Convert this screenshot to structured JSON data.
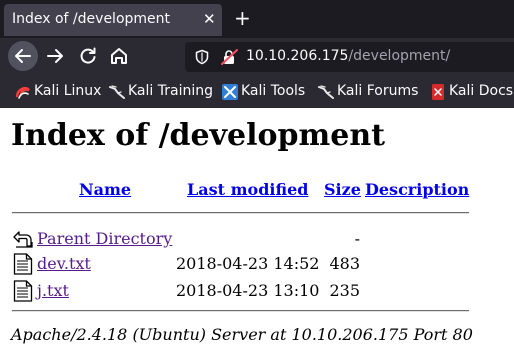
{
  "browser": {
    "tab": {
      "title": "Index of /development",
      "close_glyph": "✕"
    },
    "new_tab_glyph": "+",
    "url": {
      "host": "10.10.206.175",
      "path": "/development/"
    },
    "bookmarks": [
      {
        "label": "Kali Linux",
        "icon": "kali-linux-icon"
      },
      {
        "label": "Kali Training",
        "icon": "kali-dragon-icon"
      },
      {
        "label": "Kali Tools",
        "icon": "kali-tools-icon"
      },
      {
        "label": "Kali Forums",
        "icon": "kali-dragon-icon"
      },
      {
        "label": "Kali Docs",
        "icon": "kali-docs-icon"
      }
    ]
  },
  "page": {
    "title": "Index of /development",
    "columns": {
      "name": "Name",
      "last_modified": "Last modified",
      "size": "Size",
      "description": "Description"
    },
    "parent": {
      "name": "Parent Directory",
      "size": "-"
    },
    "files": [
      {
        "name": "dev.txt",
        "modified": "2018-04-23 14:52",
        "size": "483"
      },
      {
        "name": "j.txt",
        "modified": "2018-04-23 13:10",
        "size": "235"
      }
    ],
    "footer": "Apache/2.4.18 (Ubuntu) Server at 10.10.206.175 Port 80"
  },
  "colors": {
    "tabbar": "#1c1b22",
    "toolbar": "#2b2a33",
    "link": "#0000ee",
    "visited": "#551a8b"
  }
}
